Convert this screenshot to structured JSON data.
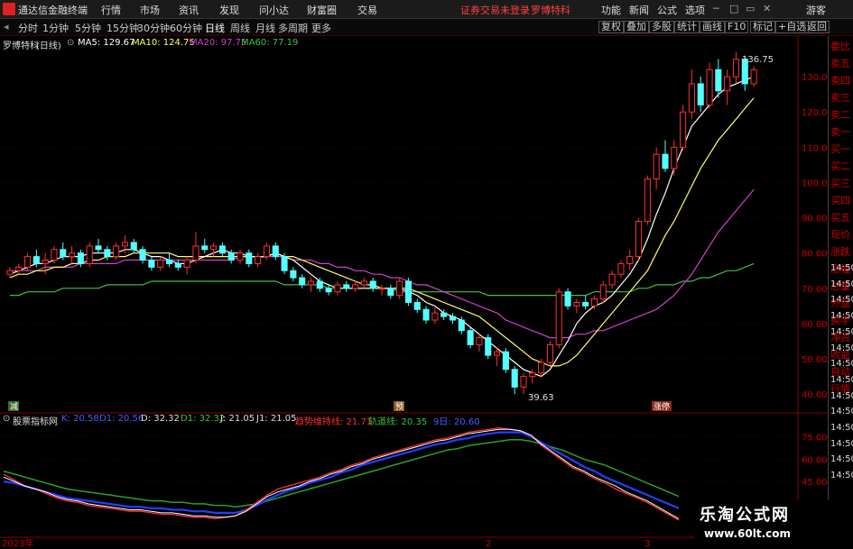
{
  "titlebar": {
    "app": "通达信金融终端",
    "menu": [
      "行情",
      "市场",
      "资讯",
      "发现",
      "问小达",
      "财富圈",
      "交易"
    ],
    "warning": "证券交易未登录",
    "stock_name": "罗博特科",
    "right": [
      "功能",
      "新闻",
      "公式",
      "选项"
    ],
    "guest": "游客"
  },
  "toolbar": {
    "periods": [
      "分时",
      "1分钟",
      "5分钟",
      "15分钟",
      "30分钟",
      "60分钟",
      "日线",
      "周线",
      "月线",
      "多周期",
      "更多"
    ],
    "active_period": "日线",
    "right_buttons": [
      "复权",
      "叠加",
      "多股",
      "统计",
      "画线",
      "F10",
      "标记",
      "+自选",
      "返回"
    ]
  },
  "ma_legend": {
    "title": "罗博特科",
    "period": "(日线)",
    "ma5": "MA5: 129.67",
    "ma10": "MA10: 124.75",
    "ma20": "MA20: 97.75",
    "ma60": "MA60: 77.19",
    "colors": {
      "ma5": "#ffffff",
      "ma10": "#ffff66",
      "ma20": "#d040d0",
      "ma60": "#40c040"
    }
  },
  "price_axis": {
    "ticks": [
      "130.00",
      "120.00",
      "110.00",
      "100.00",
      "90.00",
      "80.00",
      "70.00",
      "60.00",
      "50.00",
      "40.00"
    ],
    "ylim": [
      38,
      140
    ]
  },
  "annotations": {
    "high": "136.75",
    "low": "39.63"
  },
  "event_tags": [
    "减",
    "预",
    "涨停"
  ],
  "indicator_legend": {
    "name": "股票指标网",
    "k": "K: 20.58",
    "d_blue": "D1: 20.56",
    "d": "D: 32.32",
    "d1": "D1: 32.32",
    "j": "J: 21.05",
    "j1": "J1: 21.05",
    "trend": "趋势维持线: 21.71",
    "track": "轨道线: 20.35",
    "extra": "9日: 20.60"
  },
  "indicator_axis": {
    "ticks": [
      "75.00",
      "60.00",
      "45.00"
    ]
  },
  "date_axis": [
    "2023年",
    "2",
    "3"
  ],
  "sidebar_items": [
    "委比",
    "卖五",
    "卖四",
    "卖三",
    "卖二",
    "卖一",
    "买一",
    "买二",
    "买三",
    "买四",
    "买五",
    "现价",
    "涨跌",
    "涨幅",
    "总量",
    "外盘",
    "换手",
    "净资",
    "收益",
    "自动",
    "行情",
    "14:50",
    "14:50",
    "14:50",
    "14:50",
    "14:50",
    "14:50",
    "14:50",
    "14:50",
    "14:50",
    "14:50",
    "14:50",
    "14:50",
    "14:50",
    "14:50"
  ],
  "watermark": {
    "title": "乐淘公式网",
    "url": "www.60lt.com"
  },
  "chart_data": {
    "type": "candlestick",
    "ylim": [
      38,
      140
    ],
    "candles": [
      [
        74,
        76,
        73,
        75
      ],
      [
        75,
        77,
        74,
        76
      ],
      [
        76,
        80,
        75,
        79
      ],
      [
        79,
        81,
        76,
        77
      ],
      [
        77,
        80,
        74,
        78
      ],
      [
        78,
        82,
        77,
        81
      ],
      [
        81,
        83,
        78,
        79
      ],
      [
        79,
        82,
        77,
        80
      ],
      [
        80,
        81,
        76,
        77
      ],
      [
        77,
        83,
        76,
        82
      ],
      [
        82,
        84,
        80,
        81
      ],
      [
        81,
        82,
        78,
        79
      ],
      [
        79,
        83,
        78,
        82
      ],
      [
        82,
        85,
        80,
        83
      ],
      [
        83,
        84,
        80,
        81
      ],
      [
        81,
        82,
        77,
        78
      ],
      [
        78,
        79,
        75,
        76
      ],
      [
        76,
        79,
        75,
        78
      ],
      [
        78,
        80,
        76,
        77
      ],
      [
        77,
        78,
        75,
        76
      ],
      [
        76,
        79,
        74,
        78
      ],
      [
        78,
        86,
        77,
        82
      ],
      [
        82,
        84,
        80,
        81
      ],
      [
        81,
        83,
        79,
        82
      ],
      [
        82,
        83,
        79,
        80
      ],
      [
        80,
        81,
        77,
        78
      ],
      [
        78,
        81,
        77,
        80
      ],
      [
        80,
        81,
        76,
        77
      ],
      [
        77,
        80,
        76,
        79
      ],
      [
        79,
        83,
        78,
        82
      ],
      [
        82,
        83,
        78,
        79
      ],
      [
        79,
        80,
        74,
        75
      ],
      [
        75,
        76,
        72,
        73
      ],
      [
        73,
        74,
        70,
        71
      ],
      [
        71,
        73,
        69,
        72
      ],
      [
        72,
        73,
        69,
        70
      ],
      [
        70,
        71,
        68,
        69
      ],
      [
        69,
        72,
        68,
        71
      ],
      [
        71,
        72,
        69,
        70
      ],
      [
        70,
        72,
        69,
        71
      ],
      [
        71,
        73,
        70,
        72
      ],
      [
        72,
        73,
        69,
        70
      ],
      [
        70,
        71,
        68,
        70
      ],
      [
        70,
        71,
        67,
        68
      ],
      [
        68,
        73,
        67,
        72
      ],
      [
        72,
        73,
        65,
        66
      ],
      [
        66,
        67,
        63,
        64
      ],
      [
        64,
        65,
        60,
        61
      ],
      [
        61,
        65,
        60,
        63
      ],
      [
        63,
        64,
        61,
        62
      ],
      [
        62,
        63,
        60,
        61
      ],
      [
        61,
        62,
        57,
        58
      ],
      [
        58,
        59,
        53,
        54
      ],
      [
        54,
        57,
        52,
        56
      ],
      [
        56,
        57,
        50,
        51
      ],
      [
        51,
        53,
        48,
        52
      ],
      [
        52,
        53,
        46,
        47
      ],
      [
        47,
        48,
        40,
        42
      ],
      [
        42,
        46,
        40,
        45
      ],
      [
        45,
        47,
        43,
        46
      ],
      [
        46,
        50,
        45,
        49
      ],
      [
        49,
        55,
        48,
        54
      ],
      [
        54,
        70,
        53,
        69
      ],
      [
        69,
        70,
        64,
        65
      ],
      [
        65,
        67,
        63,
        66
      ],
      [
        66,
        68,
        64,
        65
      ],
      [
        65,
        68,
        64,
        67
      ],
      [
        67,
        72,
        66,
        71
      ],
      [
        71,
        75,
        70,
        74
      ],
      [
        74,
        78,
        73,
        77
      ],
      [
        77,
        81,
        75,
        79
      ],
      [
        79,
        90,
        78,
        89
      ],
      [
        89,
        102,
        88,
        101
      ],
      [
        101,
        110,
        98,
        108
      ],
      [
        108,
        112,
        103,
        104
      ],
      [
        104,
        112,
        102,
        110
      ],
      [
        110,
        122,
        109,
        120
      ],
      [
        120,
        132,
        118,
        128
      ],
      [
        128,
        130,
        120,
        122
      ],
      [
        122,
        134,
        121,
        132
      ],
      [
        132,
        135,
        124,
        126
      ],
      [
        126,
        132,
        122,
        130
      ],
      [
        130,
        137,
        128,
        135
      ],
      [
        135,
        136,
        126,
        128
      ],
      [
        128,
        133,
        127,
        132
      ]
    ],
    "ma5": [
      74,
      75,
      76,
      77,
      77,
      78,
      79,
      79,
      79,
      80,
      80,
      80,
      80,
      81,
      81,
      80,
      79,
      79,
      78,
      77,
      77,
      78,
      79,
      80,
      81,
      80,
      80,
      79,
      79,
      79,
      80,
      79,
      78,
      76,
      74,
      72,
      71,
      70,
      70,
      70,
      70,
      70,
      70,
      70,
      70,
      69,
      68,
      66,
      65,
      63,
      62,
      61,
      59,
      57,
      55,
      53,
      51,
      49,
      47,
      46,
      45,
      47,
      51,
      55,
      60,
      63,
      65,
      66,
      68,
      71,
      74,
      78,
      84,
      91,
      97,
      104,
      110,
      116,
      119,
      122,
      125,
      127,
      128,
      129,
      130
    ],
    "ma10": [
      73,
      74,
      74,
      75,
      75,
      76,
      76,
      77,
      77,
      78,
      78,
      79,
      79,
      79,
      80,
      80,
      80,
      80,
      80,
      79,
      79,
      79,
      79,
      79,
      79,
      79,
      79,
      79,
      79,
      79,
      80,
      79,
      79,
      78,
      77,
      76,
      75,
      74,
      73,
      72,
      71,
      71,
      70,
      70,
      70,
      70,
      69,
      68,
      67,
      66,
      65,
      64,
      63,
      62,
      60,
      58,
      56,
      54,
      52,
      50,
      49,
      48,
      48,
      49,
      51,
      54,
      57,
      60,
      63,
      66,
      69,
      72,
      75,
      80,
      85,
      89,
      94,
      99,
      104,
      108,
      112,
      115,
      118,
      121,
      124
    ],
    "ma20": [
      75,
      75,
      75,
      75,
      76,
      76,
      76,
      76,
      77,
      77,
      77,
      77,
      77,
      78,
      78,
      78,
      78,
      78,
      78,
      78,
      78,
      78,
      78,
      78,
      78,
      78,
      79,
      79,
      79,
      79,
      79,
      79,
      78,
      78,
      78,
      77,
      77,
      76,
      76,
      75,
      75,
      74,
      74,
      73,
      73,
      72,
      71,
      71,
      70,
      69,
      68,
      67,
      66,
      65,
      64,
      63,
      61,
      60,
      59,
      58,
      57,
      56,
      56,
      56,
      57,
      57,
      58,
      58,
      59,
      60,
      61,
      62,
      63,
      64,
      66,
      68,
      71,
      74,
      78,
      82,
      86,
      89,
      92,
      95,
      98
    ],
    "ma60": [
      68,
      68,
      69,
      69,
      69,
      69,
      70,
      70,
      70,
      70,
      70,
      71,
      71,
      71,
      71,
      71,
      72,
      72,
      72,
      72,
      72,
      72,
      72,
      72,
      72,
      72,
      72,
      72,
      72,
      72,
      72,
      71,
      71,
      71,
      71,
      71,
      70,
      70,
      70,
      70,
      70,
      70,
      70,
      70,
      69,
      69,
      69,
      69,
      69,
      69,
      69,
      69,
      69,
      69,
      68,
      68,
      68,
      68,
      68,
      68,
      68,
      68,
      68,
      68,
      68,
      68,
      69,
      69,
      69,
      69,
      69,
      70,
      70,
      71,
      71,
      71,
      72,
      72,
      73,
      73,
      74,
      75,
      75,
      76,
      77
    ],
    "indicator": {
      "ylim": [
        10,
        85
      ],
      "k": [
        48,
        45,
        42,
        40,
        38,
        35,
        33,
        32,
        30,
        29,
        28,
        27,
        26,
        26,
        25,
        24,
        24,
        23,
        22,
        22,
        21,
        21,
        22,
        25,
        30,
        35,
        38,
        40,
        42,
        45,
        47,
        50,
        52,
        55,
        57,
        60,
        62,
        64,
        66,
        68,
        70,
        72,
        73,
        75,
        77,
        78,
        79,
        80,
        80,
        79,
        76,
        70,
        65,
        60,
        55,
        52,
        48,
        45,
        42,
        38,
        35,
        32,
        28,
        24,
        20
      ],
      "d": [
        45,
        44,
        42,
        40,
        38,
        36,
        34,
        33,
        32,
        31,
        30,
        29,
        28,
        28,
        27,
        27,
        26,
        26,
        25,
        25,
        24,
        24,
        24,
        26,
        29,
        33,
        36,
        39,
        41,
        44,
        46,
        48,
        51,
        53,
        56,
        58,
        60,
        62,
        64,
        66,
        68,
        70,
        71,
        73,
        74,
        76,
        77,
        78,
        78,
        78,
        75,
        71,
        67,
        63,
        59,
        55,
        52,
        48,
        45,
        42,
        39,
        36,
        33,
        30,
        27
      ],
      "j": [
        50,
        46,
        42,
        40,
        37,
        34,
        32,
        31,
        29,
        28,
        27,
        26,
        25,
        25,
        24,
        23,
        23,
        22,
        21,
        21,
        20,
        21,
        22,
        26,
        31,
        36,
        40,
        42,
        44,
        46,
        48,
        51,
        53,
        56,
        58,
        61,
        63,
        65,
        67,
        69,
        71,
        73,
        74,
        76,
        78,
        79,
        80,
        81,
        80,
        79,
        76,
        69,
        64,
        59,
        54,
        51,
        47,
        44,
        40,
        37,
        34,
        31,
        27,
        23,
        19
      ],
      "trend": [
        52,
        50,
        48,
        46,
        44,
        42,
        40,
        39,
        38,
        37,
        36,
        35,
        34,
        33,
        32,
        32,
        31,
        31,
        30,
        30,
        29,
        29,
        28,
        29,
        30,
        32,
        34,
        36,
        38,
        40,
        42,
        44,
        46,
        48,
        50,
        52,
        54,
        56,
        58,
        60,
        62,
        64,
        66,
        67,
        69,
        70,
        71,
        72,
        73,
        73,
        72,
        70,
        68,
        66,
        63,
        60,
        58,
        56,
        53,
        50,
        47,
        44,
        41,
        38,
        35
      ]
    }
  }
}
